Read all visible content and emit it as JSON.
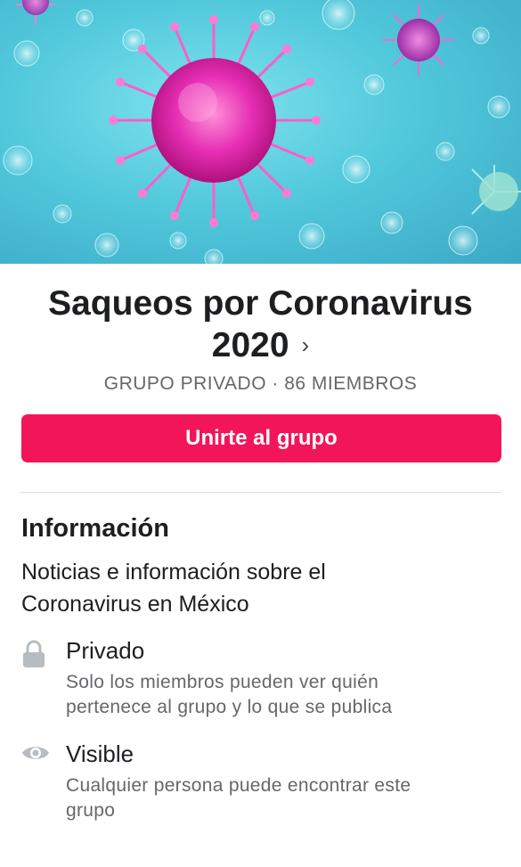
{
  "cover": {
    "image": "coronavirus-illustration"
  },
  "group": {
    "title": "Saqueos por Coronavirus 2020",
    "title_chevron": "›",
    "meta": "GRUPO PRIVADO · 86 MIEMBROS",
    "join_label": "Unirte al grupo"
  },
  "info": {
    "heading": "Información",
    "description": "Noticias e información sobre el Coronavirus en México",
    "items": [
      {
        "icon": "lock-icon",
        "title": "Privado",
        "subtitle": "Solo los miembros pueden ver quién pertenece al grupo y lo que se publica"
      },
      {
        "icon": "eye-icon",
        "title": "Visible",
        "subtitle": "Cualquier persona puede encontrar este grupo"
      }
    ]
  },
  "colors": {
    "accent": "#f2155a",
    "muted": "#65676b",
    "icon": "#b7bbc2"
  }
}
